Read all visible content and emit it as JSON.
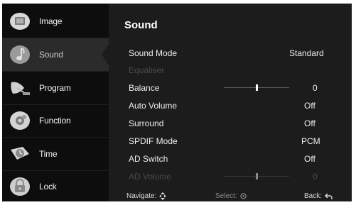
{
  "sidebar": {
    "items": [
      {
        "label": "Image",
        "icon": "image-icon"
      },
      {
        "label": "Sound",
        "icon": "music-note-icon"
      },
      {
        "label": "Program",
        "icon": "satellite-dish-icon"
      },
      {
        "label": "Function",
        "icon": "gear-icon"
      },
      {
        "label": "Time",
        "icon": "clock-icon"
      },
      {
        "label": "Lock",
        "icon": "lock-icon"
      }
    ],
    "selected": "Sound"
  },
  "panel": {
    "title": "Sound",
    "rows": [
      {
        "label": "Sound Mode",
        "value": "Standard"
      },
      {
        "label": "Equaliser",
        "value": ""
      },
      {
        "label": "Balance",
        "value": "0",
        "slider_level": 0.5
      },
      {
        "label": "Auto Volume",
        "value": "Off"
      },
      {
        "label": "Surround",
        "value": "Off"
      },
      {
        "label": "SPDIF Mode",
        "value": "PCM"
      },
      {
        "label": "AD Switch",
        "value": "Off"
      },
      {
        "label": "AD Volume",
        "value": "0",
        "slider_level": 0.5
      }
    ]
  },
  "footer": {
    "navigate_label": "Navigate:",
    "select_label": "Select:",
    "back_label": "Back:"
  },
  "colors": {
    "background": "#1c1c1c",
    "sidebar": "#0d0d0d",
    "selected_item": "#2b2b2b",
    "disabled_text": "#4a4a4a"
  }
}
